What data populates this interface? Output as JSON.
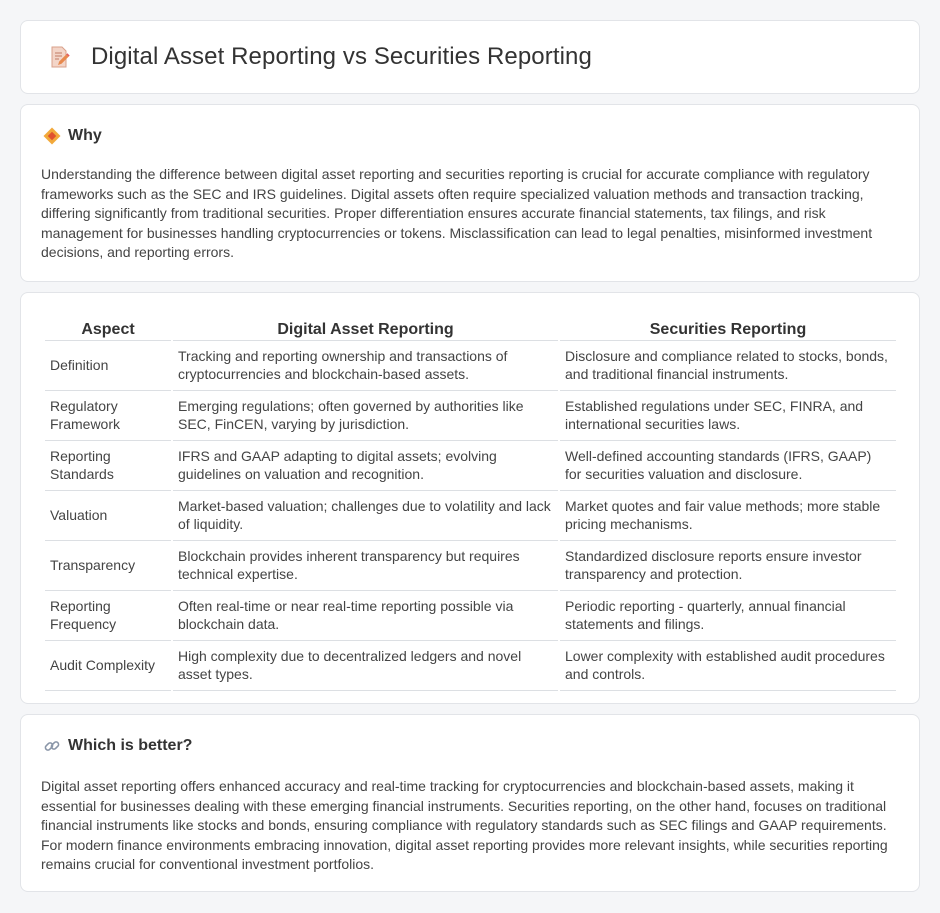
{
  "header": {
    "title": "Digital Asset Reporting vs Securities Reporting",
    "icon": "document-pencil-icon"
  },
  "why": {
    "title": "Why",
    "icon": "diamond-icon",
    "body": "Understanding the difference between digital asset reporting and securities reporting is crucial for accurate compliance with regulatory frameworks such as the SEC and IRS guidelines. Digital assets often require specialized valuation methods and transaction tracking, differing significantly from traditional securities. Proper differentiation ensures accurate financial statements, tax filings, and risk management for businesses handling cryptocurrencies or tokens. Misclassification can lead to legal penalties, misinformed investment decisions, and reporting errors."
  },
  "table": {
    "headers": [
      "Aspect",
      "Digital Asset Reporting",
      "Securities Reporting"
    ],
    "rows": [
      [
        "Definition",
        "Tracking and reporting ownership and transactions of cryptocurrencies and blockchain-based assets.",
        "Disclosure and compliance related to stocks, bonds, and traditional financial instruments."
      ],
      [
        "Regulatory Framework",
        "Emerging regulations; often governed by authorities like SEC, FinCEN, varying by jurisdiction.",
        "Established regulations under SEC, FINRA, and international securities laws."
      ],
      [
        "Reporting Standards",
        "IFRS and GAAP adapting to digital assets; evolving guidelines on valuation and recognition.",
        "Well-defined accounting standards (IFRS, GAAP) for securities valuation and disclosure."
      ],
      [
        "Valuation",
        "Market-based valuation; challenges due to volatility and lack of liquidity.",
        "Market quotes and fair value methods; more stable pricing mechanisms."
      ],
      [
        "Transparency",
        "Blockchain provides inherent transparency but requires technical expertise.",
        "Standardized disclosure reports ensure investor transparency and protection."
      ],
      [
        "Reporting Frequency",
        "Often real-time or near real-time reporting possible via blockchain data.",
        "Periodic reporting - quarterly, annual financial statements and filings."
      ],
      [
        "Audit Complexity",
        "High complexity due to decentralized ledgers and novel asset types.",
        "Lower complexity with established audit procedures and controls."
      ]
    ]
  },
  "better": {
    "title": "Which is better?",
    "icon": "link-icon",
    "body": "Digital asset reporting offers enhanced accuracy and real-time tracking for cryptocurrencies and blockchain-based assets, making it essential for businesses dealing with these emerging financial instruments. Securities reporting, on the other hand, focuses on traditional financial instruments like stocks and bonds, ensuring compliance with regulatory standards such as SEC filings and GAAP requirements. For modern finance environments embracing innovation, digital asset reporting provides more relevant insights, while securities reporting remains crucial for conventional investment portfolios."
  }
}
